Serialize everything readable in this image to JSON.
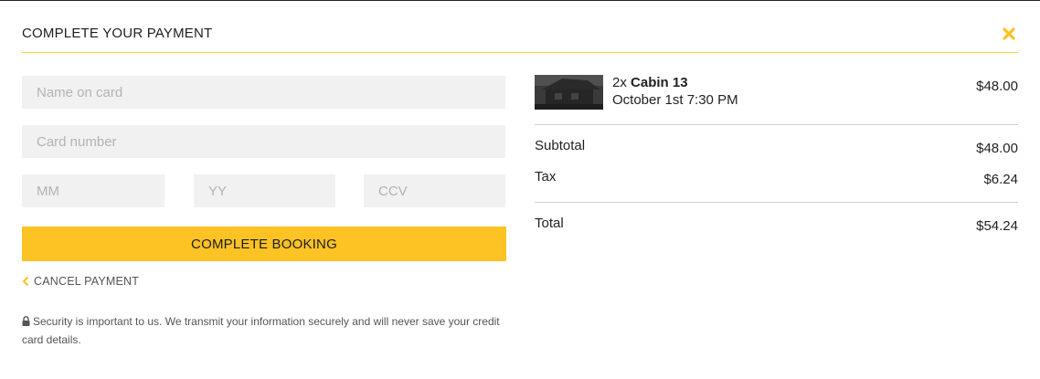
{
  "header": {
    "title": "COMPLETE YOUR PAYMENT",
    "close_icon": "close-icon",
    "accent_color": "#fdc224"
  },
  "form": {
    "name_placeholder": "Name on card",
    "name_value": "",
    "card_placeholder": "Card number",
    "card_value": "",
    "mm_placeholder": "MM",
    "mm_value": "",
    "yy_placeholder": "YY",
    "yy_value": "",
    "ccv_placeholder": "CCV",
    "ccv_value": "",
    "submit_label": "COMPLETE BOOKING",
    "cancel_label": "CANCEL PAYMENT",
    "security_text": "Security is important to us. We transmit your information securely and will never save your credit card details."
  },
  "summary": {
    "item": {
      "quantity": "2x",
      "name": "Cabin 13",
      "date": "October 1st 7:30 PM",
      "price": "$48.00"
    },
    "subtotal_label": "Subtotal",
    "subtotal_value": "$48.00",
    "tax_label": "Tax",
    "tax_value": "$6.24",
    "total_label": "Total",
    "total_value": "$54.24"
  }
}
